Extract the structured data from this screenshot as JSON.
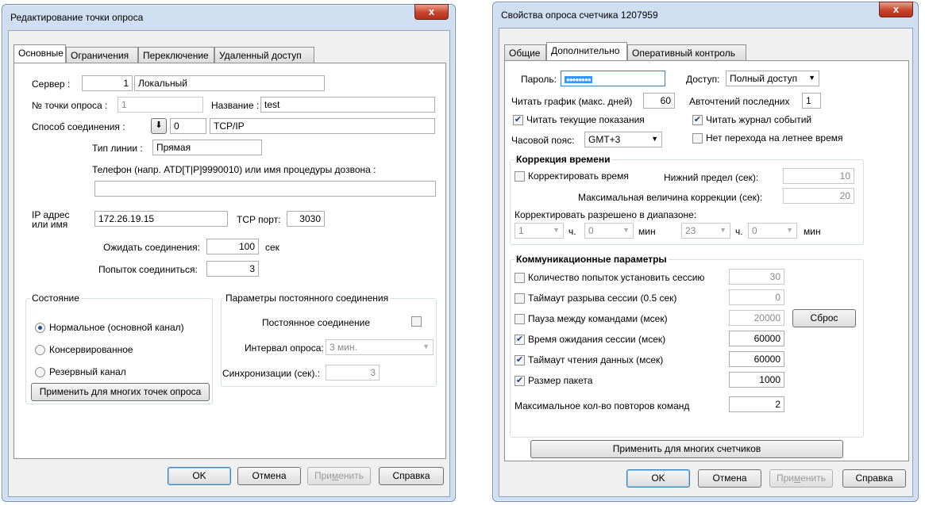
{
  "left": {
    "title": "Редактирование точки опроса",
    "close": "x",
    "tabs": [
      "Основные",
      "Ограничения",
      "Переключение",
      "Удаленный доступ"
    ],
    "server_label": "Сервер :",
    "server_num": "1",
    "server_name": "Локальный",
    "point_label": "№ точки опроса :",
    "point_value": "1",
    "name_label": "Название :",
    "name_value": "test",
    "conn_label": "Способ соединения :",
    "conn_num": "0",
    "conn_type": "TCP/IP",
    "linetype_label": "Тип линии :",
    "linetype_value": "Прямая",
    "phone_label": "Телефон (напр. ATD[T|P]9990010) или имя процедуры дозвона :",
    "phone_value": "",
    "ip_label1": "IP адрес",
    "ip_label2": "или имя",
    "ip_value": "172.26.19.15",
    "port_label": "TCP порт:",
    "port_value": "3030",
    "wait_label": "Ожидать соединения:",
    "wait_value": "100",
    "wait_unit": "сек",
    "tries_label": "Попыток соединиться:",
    "tries_value": "3",
    "state_group": "Состояние",
    "radio": [
      {
        "label": "Нормальное (основной канал)",
        "checked": true
      },
      {
        "label": "Консервированное",
        "checked": false
      },
      {
        "label": "Резервный канал",
        "checked": false
      }
    ],
    "apply_many": "Применить для многих точек опроса",
    "perm_group": "Параметры постоянного соединения",
    "perm_label": "Постоянное соединение",
    "interval_label": "Интервал опроса:",
    "interval_value": "3 мин.",
    "sync_label": "Синхронизации (сек).:",
    "sync_value": "3",
    "ok": "OK",
    "cancel": "Отмена",
    "apply_pre": "При",
    "apply_u": "м",
    "apply_post": "енить",
    "help": "Справка"
  },
  "right": {
    "title": "Свойства опроса счетчика 1207959",
    "close": "x",
    "tabs": [
      "Общие",
      "Дополнительно",
      "Оперативный контроль"
    ],
    "password_label": "Пароль:",
    "password_value": "●●●●●●●●",
    "access_label": "Доступ:",
    "access_value": "Полный доступ",
    "read_graph_label": "Читать график (макс. дней)",
    "read_graph_value": "60",
    "autoread_label": "Авточтений последних",
    "autoread_value": "1",
    "read_current": "Читать текущие показания",
    "read_journal": "Читать журнал событий",
    "tz_label": "Часовой пояс:",
    "tz_value": "GMT+3",
    "no_dst": "Нет перехода на летнее время",
    "timecorr_group": "Коррекция времени",
    "correct_time": "Корректировать время",
    "lower_label": "Нижний предел (сек):",
    "lower_value": "10",
    "maxcorr_label": "Максимальная величина коррекции (сек):",
    "maxcorr_value": "20",
    "range_label": "Корректировать разрешено в диапазоне:",
    "range": {
      "h1": "1",
      "m1": "0",
      "h2": "23",
      "m2": "0",
      "h": "ч.",
      "min": "мин"
    },
    "comm_group": "Коммуникационные параметры",
    "comm": [
      {
        "label": "Количество попыток установить сессию",
        "checked": false,
        "value": "30",
        "disabled": true
      },
      {
        "label": "Таймаут разрыва сессии (0.5 сек)",
        "checked": false,
        "value": "0",
        "disabled": true
      },
      {
        "label": "Пауза между командами (мсек)",
        "checked": false,
        "value": "20000",
        "disabled": true
      },
      {
        "label": "Время ожидания сессии (мсек)",
        "checked": true,
        "value": "60000",
        "disabled": false
      },
      {
        "label": "Таймаут чтения данных (мсек)",
        "checked": true,
        "value": "60000",
        "disabled": false
      },
      {
        "label": "Размер пакета",
        "checked": true,
        "value": "1000",
        "disabled": false
      }
    ],
    "reset": "Сброс",
    "max_repeat_label": "Максимальное кол-во повторов команд",
    "max_repeat_value": "2",
    "apply_many": "Применить для многих счетчиков",
    "ok": "OK",
    "cancel": "Отмена",
    "apply_pre": "При",
    "apply_u": "м",
    "apply_post": "енить",
    "help": "Справка"
  }
}
